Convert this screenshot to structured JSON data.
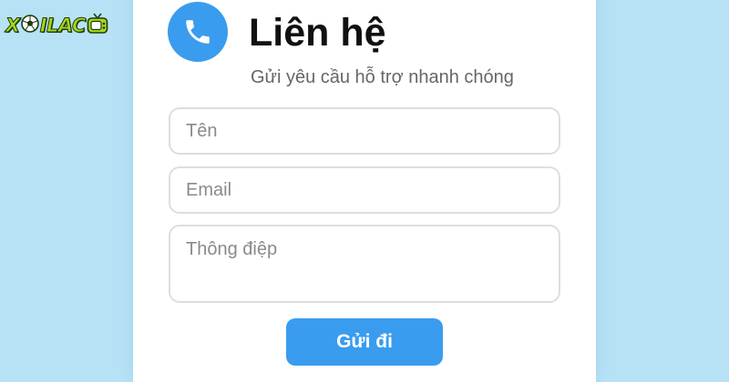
{
  "logo": {
    "text_start": "X",
    "text_end": "IL",
    "text_last": "AC"
  },
  "header": {
    "title": "Liên hệ",
    "subtitle": "Gửi yêu cầu hỗ trợ nhanh chóng"
  },
  "form": {
    "name_placeholder": "Tên",
    "email_placeholder": "Email",
    "message_placeholder": "Thông điệp",
    "submit_label": "Gửi đi"
  },
  "colors": {
    "background": "#b7e2f6",
    "accent": "#3a9cee",
    "logo_green": "#a7d81c"
  },
  "icons": {
    "logo_ball": "soccer-ball-icon",
    "logo_tv": "tv-icon",
    "contact": "phone-icon"
  }
}
